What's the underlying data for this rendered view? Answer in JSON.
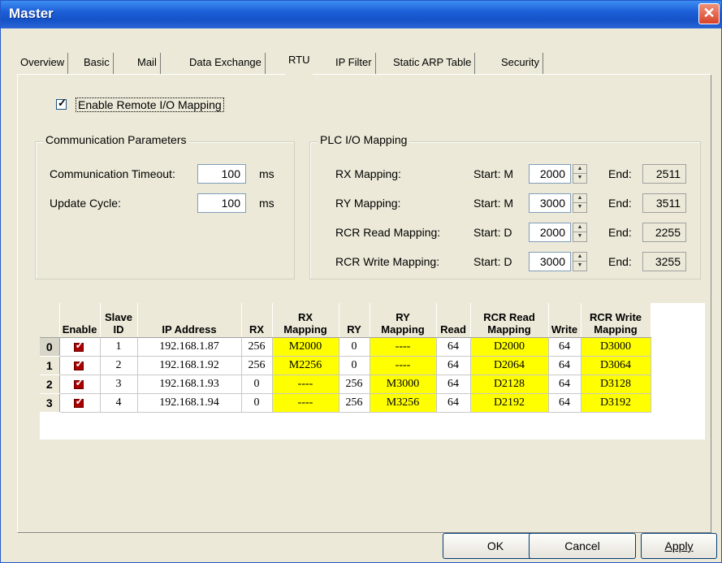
{
  "window": {
    "title": "Master",
    "close_glyph": "✕"
  },
  "tabs": [
    {
      "label": "Overview"
    },
    {
      "label": "Basic"
    },
    {
      "label": "Mail"
    },
    {
      "label": "Data Exchange"
    },
    {
      "label": "RTU"
    },
    {
      "label": "IP Filter"
    },
    {
      "label": "Static ARP Table"
    },
    {
      "label": "Security"
    }
  ],
  "active_tab": "RTU",
  "enable_remote_io": {
    "label": "Enable Remote I/O Mapping",
    "checked": true,
    "mark": "✓"
  },
  "comm_params": {
    "title": "Communication Parameters",
    "timeout_label": "Communication Timeout:",
    "timeout_value": "100",
    "timeout_unit": "ms",
    "update_label": "Update Cycle:",
    "update_value": "100",
    "update_unit": "ms"
  },
  "plc_mapping": {
    "title": "PLC I/O Mapping",
    "start_label": "Start:",
    "end_label": "End:",
    "rows": [
      {
        "label": "RX Mapping:",
        "area": "M",
        "start": "2000",
        "end": "2511"
      },
      {
        "label": "RY Mapping:",
        "area": "M",
        "start": "3000",
        "end": "3511"
      },
      {
        "label": "RCR Read Mapping:",
        "area": "D",
        "start": "2000",
        "end": "2255"
      },
      {
        "label": "RCR Write Mapping:",
        "area": "D",
        "start": "3000",
        "end": "3255"
      }
    ]
  },
  "table": {
    "headers": {
      "enable": "Enable",
      "slave_id_1": "Slave",
      "slave_id_2": "ID",
      "ip": "IP Address",
      "rx": "RX",
      "rx_map_1": "RX",
      "rx_map_2": "Mapping",
      "ry": "RY",
      "ry_map_1": "RY",
      "ry_map_2": "Mapping",
      "read": "Read",
      "rcr_read_1": "RCR Read",
      "rcr_read_2": "Mapping",
      "write": "Write",
      "rcr_write_1": "RCR Write",
      "rcr_write_2": "Mapping"
    },
    "rows": [
      {
        "idx": "0",
        "slave_id": "1",
        "ip": "192.168.1.87",
        "rx": "256",
        "rx_map": "M2000",
        "ry": "0",
        "ry_map": "----",
        "read": "64",
        "rcr_read": "D2000",
        "write": "64",
        "rcr_write": "D3000"
      },
      {
        "idx": "1",
        "slave_id": "2",
        "ip": "192.168.1.92",
        "rx": "256",
        "rx_map": "M2256",
        "ry": "0",
        "ry_map": "----",
        "read": "64",
        "rcr_read": "D2064",
        "write": "64",
        "rcr_write": "D3064"
      },
      {
        "idx": "2",
        "slave_id": "3",
        "ip": "192.168.1.93",
        "rx": "0",
        "rx_map": "----",
        "ry": "256",
        "ry_map": "M3000",
        "read": "64",
        "rcr_read": "D2128",
        "write": "64",
        "rcr_write": "D3128"
      },
      {
        "idx": "3",
        "slave_id": "4",
        "ip": "192.168.1.94",
        "rx": "0",
        "rx_map": "----",
        "ry": "256",
        "ry_map": "M3256",
        "read": "64",
        "rcr_read": "D2192",
        "write": "64",
        "rcr_write": "D3192"
      }
    ],
    "enable_check": "✓"
  },
  "buttons": {
    "ok": "OK",
    "cancel": "Cancel",
    "apply": "Apply"
  },
  "colors": {
    "highlight": "#ffff00",
    "titlebar": "#1c5fd8"
  }
}
